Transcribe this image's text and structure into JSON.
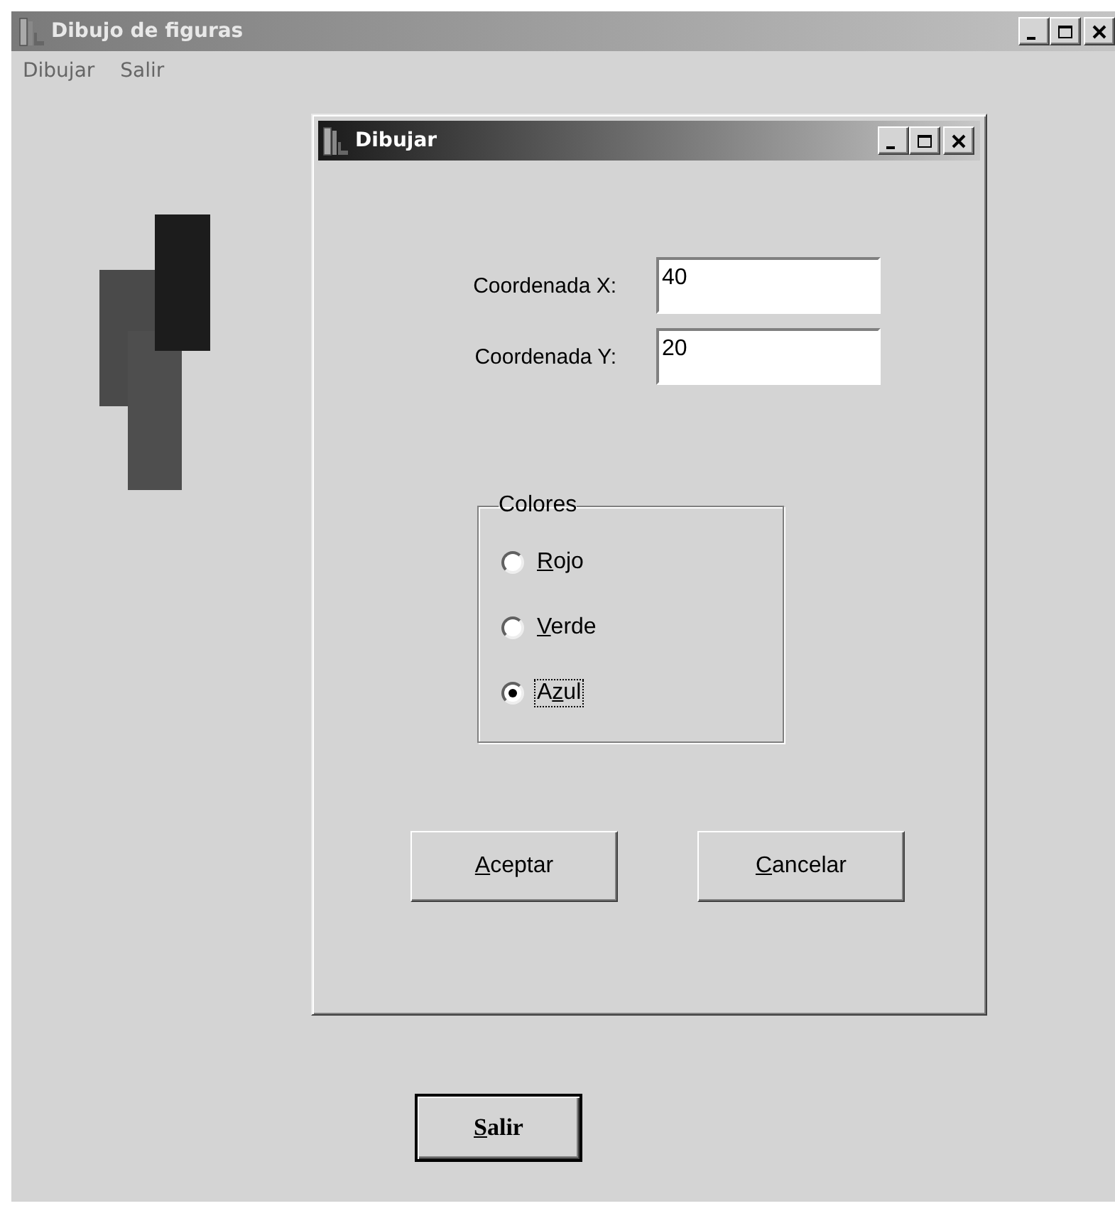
{
  "window": {
    "title": "Dibujo de figuras",
    "active": false
  },
  "menu": [
    {
      "label": "Dibujar"
    },
    {
      "label": "Salir"
    }
  ],
  "dialog": {
    "title": "Dibujar",
    "active": true,
    "fields": [
      {
        "label": "Coordenada X:",
        "value": "40"
      },
      {
        "label": "Coordenada Y:",
        "value": "20"
      }
    ],
    "group": {
      "title": "Colores",
      "options": [
        {
          "label": {
            "key": "R",
            "after": "ojo"
          },
          "selected": false,
          "focused": false
        },
        {
          "label": {
            "key": "V",
            "after": "erde"
          },
          "selected": false,
          "focused": false
        },
        {
          "label": {
            "before": "A",
            "key": "z",
            "after": "ul"
          },
          "selected": true,
          "focused": true
        }
      ]
    },
    "buttons": [
      {
        "label": {
          "key": "A",
          "after": "ceptar"
        }
      },
      {
        "label": {
          "key": "C",
          "after": "ancelar"
        }
      }
    ]
  },
  "main_button": {
    "label": {
      "key": "S",
      "after": "alir"
    },
    "default": true
  }
}
